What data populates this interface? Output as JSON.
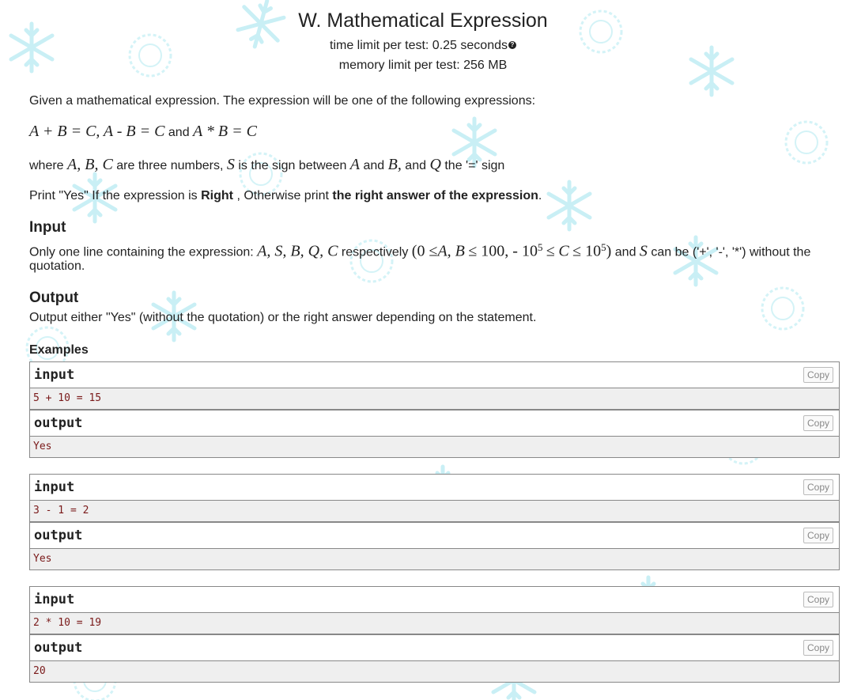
{
  "problem": {
    "title": "W. Mathematical Expression",
    "time_limit": "time limit per test: 0.25 seconds",
    "memory_limit": "memory limit per test: 256 MB"
  },
  "statement": {
    "intro": "Given a mathematical expression. The expression will be one of the following expressions:",
    "expr1": "A + B = C,",
    "expr2": "A - B = C",
    "and_word": "and",
    "expr3": "A * B = C",
    "where_prefix": "where",
    "where_vars": "A, B, C",
    "where_mid": "are three numbers,",
    "var_s": "S",
    "where_mid2": "is the sign between",
    "var_a": "A",
    "and_text": "and",
    "var_b": "B,",
    "and_text2": "and",
    "var_q": "Q",
    "where_end": "the '=' sign",
    "print_prefix": "Print \"Yes\" If the expression is",
    "print_right": "Right",
    "print_mid": ", Otherwise print",
    "print_answer": "the right answer of the expression",
    "print_end": "."
  },
  "input_section": {
    "title": "Input",
    "prefix": "Only one line containing the expression:",
    "vars": "A, S, B, Q, C",
    "respectively": "respectively",
    "constraint_open": "(0 ≤",
    "constraint_ab": "A, B",
    "constraint_mid": "≤ 100,  - 10",
    "exp1": "5",
    "constraint_le": "≤",
    "constraint_c": "C",
    "constraint_le2": "≤ 10",
    "exp2": "5",
    "constraint_close": ")",
    "and_word": "and",
    "var_s": "S",
    "suffix": "can be ('+', '-', '*') without the",
    "line2": "quotation."
  },
  "output_section": {
    "title": "Output",
    "text": "Output either \"Yes\" (without the quotation) or the right answer depending on the statement."
  },
  "examples": {
    "title": "Examples",
    "items": [
      {
        "input_label": "input",
        "input": "5 + 10 = 15",
        "output_label": "output",
        "output": "Yes",
        "copy": "Copy"
      },
      {
        "input_label": "input",
        "input": "3 - 1 = 2",
        "output_label": "output",
        "output": "Yes",
        "copy": "Copy"
      },
      {
        "input_label": "input",
        "input": "2 * 10 = 19",
        "output_label": "output",
        "output": "20",
        "copy": "Copy"
      }
    ]
  },
  "colors": {
    "background_flakes": "#c8f0f4",
    "sample_text": "#7a1a1a",
    "sample_bg": "#efefef"
  }
}
